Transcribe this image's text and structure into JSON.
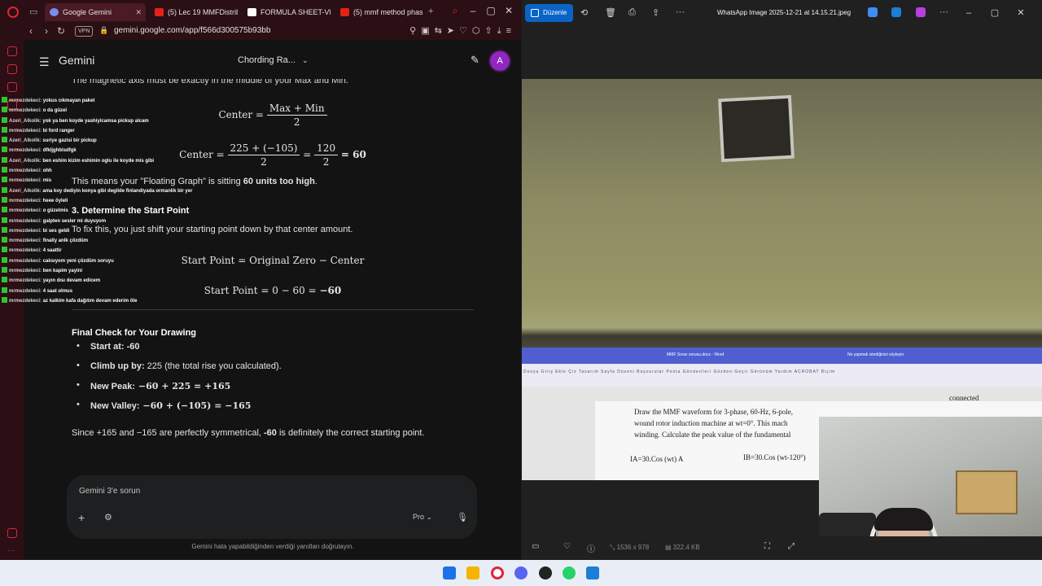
{
  "browser": {
    "tabs": [
      {
        "label": "Google Gemini",
        "active": true
      },
      {
        "label": "(5) Lec 19 MMFDistrib",
        "active": false
      },
      {
        "label": "FORMULA SHEET-VE",
        "active": false
      },
      {
        "label": "(5) mmf method phas",
        "active": false
      }
    ],
    "address": {
      "vpn": "VPN",
      "url": "gemini.google.com/app/f566d300575b93bb"
    }
  },
  "gemini": {
    "brand": "Gemini",
    "chat_title": "Chording Ra...",
    "avatar_letter": "A",
    "cut_line": "The magnetic axis must be exactly in the middle of your Max and Min.",
    "eq1": {
      "lhs": "Center =",
      "num": "Max + Min",
      "den": "2"
    },
    "eq2": {
      "lhs": "Center =",
      "num1": "225 + (−105)",
      "den1": "2",
      "eq": "=",
      "num2": "120",
      "den2": "2",
      "result": "= 60"
    },
    "floating_pre": "This means your \"Floating Graph\" is sitting ",
    "floating_bold": "60 units too high",
    "floating_post": ".",
    "step3_heading": "3. Determine the Start Point",
    "step3_text": "To fix this, you just shift your starting point down by that center amount.",
    "eq3": "Start Point = Original Zero − Center",
    "eq4_pre": "Start Point = 0 − 60 = ",
    "eq4_result": "−60",
    "final_heading": "Final Check for Your Drawing",
    "bullets": [
      {
        "label": "Start at:",
        "value": " -60"
      },
      {
        "label": "Climb up by:",
        "value": " 225 (the total rise you calculated)."
      },
      {
        "label": "New Peak:",
        "value": " −60 + 225 = +165"
      },
      {
        "label": "New Valley:",
        "value": " −60 + (−105) = −165"
      }
    ],
    "conclusion_pre": "Since +165 and −165 are perfectly symmetrical, ",
    "conclusion_bold": "-60",
    "conclusion_post": " is definitely the correct starting point.",
    "composer_placeholder": "Gemini 3'e sorun",
    "model_label": "Pro",
    "disclaimer": "Gemini hata yapabildiğinden verdiği yanıtları doğrulayın."
  },
  "chat_overlay": [
    {
      "user": "mrmezdekeci:",
      "msg": "yokus cıkmayan paket"
    },
    {
      "user": "mrmezdekeci:",
      "msg": "o da güzel"
    },
    {
      "user": "Azeri_Alkolik:",
      "msg": "yok ya ben koyde yashiyicamsa pickup alcam"
    },
    {
      "user": "mrmezdekeci:",
      "msg": "bi ford ranger"
    },
    {
      "user": "Azeri_Alkolik:",
      "msg": "suriye gazisi bir pickup"
    },
    {
      "user": "mrmezdekeci:",
      "msg": "dfkljghblsdfgk"
    },
    {
      "user": "Azeri_Alkolik:",
      "msg": "ben eshim kizim eshimin oglu ile koyde mis gibi"
    },
    {
      "user": "mrmezdekeci:",
      "msg": "ohh"
    },
    {
      "user": "mrmezdekeci:",
      "msg": "mis"
    },
    {
      "user": "Azeri_Alkolik:",
      "msg": "ama koy dediyin konya gibi degilde finlandiyada ormanlik bir yer"
    },
    {
      "user": "mrmezdekeci:",
      "msg": "heee öyleli"
    },
    {
      "user": "mrmezdekeci:",
      "msg": "o güzelmis"
    },
    {
      "user": "mrmezdekeci:",
      "msg": "galpten sesler mi duyuyom"
    },
    {
      "user": "mrmezdekeci:",
      "msg": "bi ses geldi"
    },
    {
      "user": "mrmezdekeci:",
      "msg": "finally anlk çözdüm"
    },
    {
      "user": "mrmezdekeci:",
      "msg": "4 saattir"
    },
    {
      "user": "mrmezdekeci:",
      "msg": "calısıyom yeni çözdüm soruyu"
    },
    {
      "user": "mrmezdekeci:",
      "msg": "ben kapim yayini"
    },
    {
      "user": "mrmezdekeci:",
      "msg": "yayın dısı devam edicem"
    },
    {
      "user": "mrmezdekeci:",
      "msg": "4 saat olmus"
    },
    {
      "user": "mrmezdekeci:",
      "msg": "az kalkim kafa dağıtım devam ederim öle"
    }
  ],
  "viewer": {
    "edit_label": "Düzenle",
    "file_title": "WhatsApp Image 2025-12-21 at 14.15.21.jpeg",
    "dimensions": "1536 x 978",
    "file_size": "322.4 KB",
    "photo": {
      "word_title": "MMF Sınav sorusu.docx - Word",
      "word_search": "Ne yapmak istediğinizi söyleyin",
      "word_menu": "Dosya Giriş Ekle Çiz Tasarım Sayfa Düzeni Başvurular Posta Gönderileri Gözden Geçir Görünüm Yardım ACROBAT Biçim",
      "doc_line1": "Draw the MMF waveform for 3-phase, 60-Hz, 6-pole,",
      "doc_line2": "wound rotor induction machine at wt=0°. This mach",
      "doc_line3": "winding. Calculate the peak value of the fundamental",
      "doc_ia": "IA=30.Cos (wt) A",
      "doc_ib": "IB=30.Cos (wt-120°)",
      "doc_right": "connected"
    }
  },
  "colors": {
    "accent_red": "#e0243a",
    "gemini_avatar": "#8f27c0",
    "edit_blue": "#0a64c7",
    "chat_badge": "#31c431"
  }
}
